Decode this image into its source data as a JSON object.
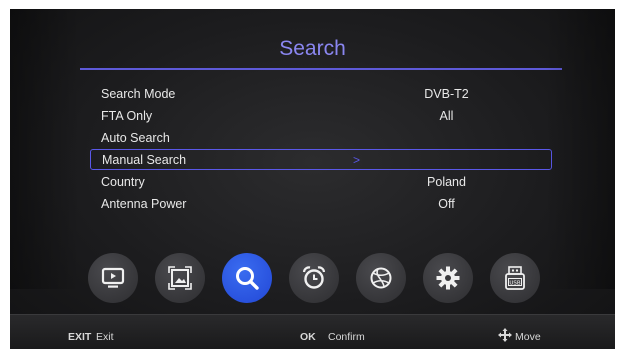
{
  "menu": {
    "title": "Search",
    "rows": [
      {
        "label": "Search Mode",
        "value": "DVB-T2"
      },
      {
        "label": "FTA Only",
        "value": "All"
      },
      {
        "label": "Auto Search",
        "value": ""
      },
      {
        "label": "Manual Search",
        "value": ""
      },
      {
        "label": "Country",
        "value": "Poland"
      },
      {
        "label": "Antenna Power",
        "value": "Off"
      }
    ],
    "selected_arrow": ">"
  },
  "icons": [
    {
      "name": "tv-icon",
      "active": false
    },
    {
      "name": "picture-icon",
      "active": false
    },
    {
      "name": "search-icon",
      "active": true
    },
    {
      "name": "alarm-clock-icon",
      "active": false
    },
    {
      "name": "globe-icon",
      "active": false
    },
    {
      "name": "gear-icon",
      "active": false
    },
    {
      "name": "usb-icon",
      "active": false
    }
  ],
  "footer": {
    "exit_key": "EXIT",
    "exit_label": "Exit",
    "ok_key": "OK",
    "ok_label": "Confirm",
    "move_label": "Move"
  },
  "colors": {
    "accent": "#5a58e8",
    "title": "#8a86f0",
    "active_icon": "#2a55e4"
  }
}
